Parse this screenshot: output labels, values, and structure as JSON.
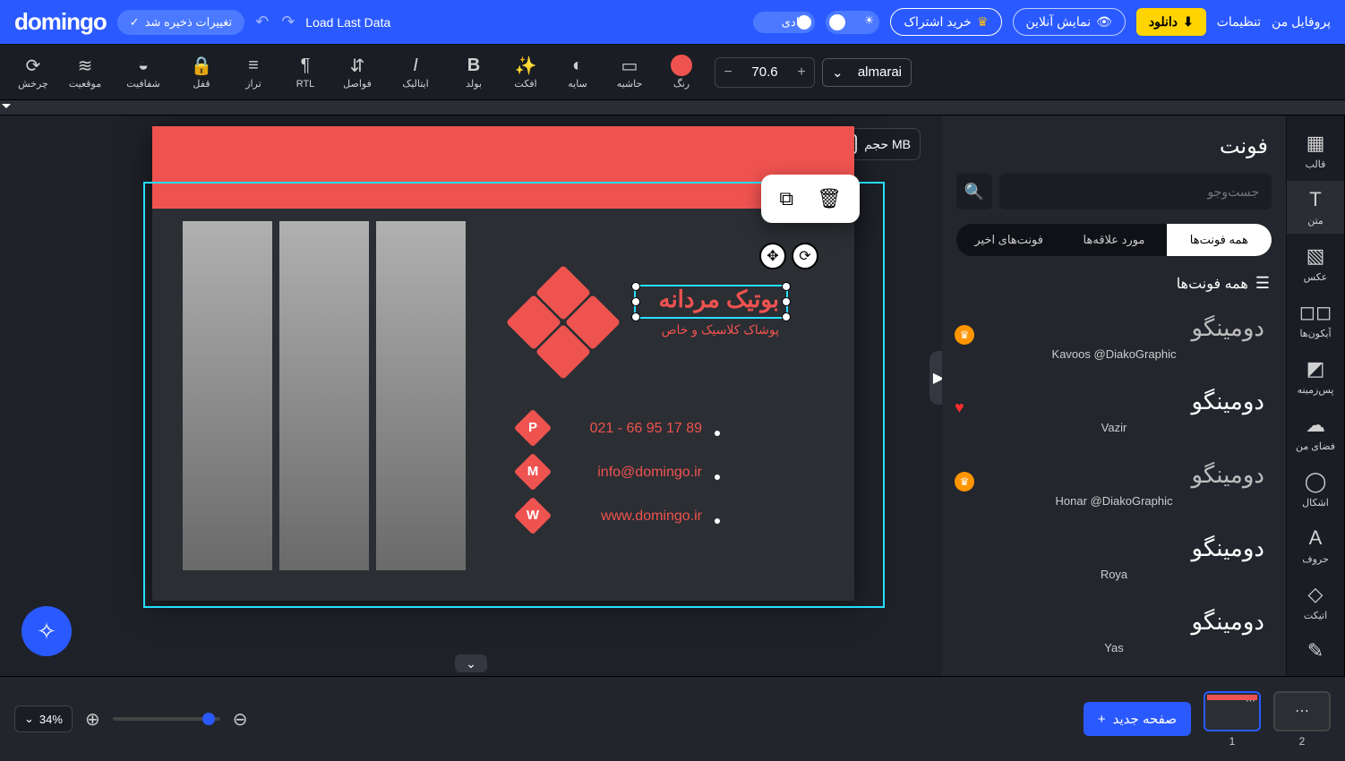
{
  "top": {
    "brand": "domingo",
    "saved": "تغییرات ذخیره شد",
    "load_last": "Load Last Data",
    "adadi": "عادی",
    "buy": "خرید اشتراک",
    "preview": "نمایش آنلاین",
    "download": "دانلود",
    "settings": "تنظیمات",
    "profile": "پروفایل من"
  },
  "toolbar": {
    "rotate": "چرخش",
    "position": "موقعیت",
    "opacity": "شفافیت",
    "lock": "قفل",
    "align": "تراز",
    "rtl": "RTL",
    "spacing": "فواصل",
    "italic": "ایتالیک",
    "bold": "بولد",
    "effect": "افکت",
    "shadow": "سایه",
    "border": "حاشیه",
    "color": "رنگ",
    "size": "70.6",
    "font": "almarai"
  },
  "canvas": {
    "size_chip": "حجم MB",
    "title": "بوتیک مردانه",
    "subtitle": "پوشاک کلاسیک و خاص",
    "phone": "021 - 66 95 17 89",
    "email": "info@domingo.ir",
    "site": "www.domingo.ir",
    "P": "P",
    "M": "M",
    "W": "W"
  },
  "panel": {
    "title": "فونت",
    "search_ph": "جست‌وجو",
    "tabs": [
      "فونت‌های اخیر",
      "مورد علاقه‌ها",
      "همه فونت‌ها"
    ],
    "section": "همه فونت‌ها",
    "fonts": [
      {
        "big": "دومینگو",
        "small": "Kavoos @DiakoGraphic",
        "badge": "crown"
      },
      {
        "big": "دومینگو",
        "small": "Vazir",
        "badge": "heart"
      },
      {
        "big": "دومینگو",
        "small": "Honar @DiakoGraphic",
        "badge": "crown"
      },
      {
        "big": "دومینگو",
        "small": "Roya",
        "badge": ""
      },
      {
        "big": "دومینگو",
        "small": "Yas",
        "badge": ""
      }
    ]
  },
  "sidebar": {
    "items": [
      {
        "label": "قالب",
        "ic": "▦"
      },
      {
        "label": "متن",
        "ic": "T"
      },
      {
        "label": "عکس",
        "ic": "▧"
      },
      {
        "label": "آیکون‌ها",
        "ic": "◻◻"
      },
      {
        "label": "پس‌زمینه",
        "ic": "◩"
      },
      {
        "label": "فضای من",
        "ic": "☁"
      },
      {
        "label": "اشکال",
        "ic": "◯"
      },
      {
        "label": "حروف",
        "ic": "A"
      },
      {
        "label": "اتیکت",
        "ic": "◇"
      },
      {
        "label": "",
        "ic": "✎"
      }
    ]
  },
  "bottom": {
    "zoom": "34%",
    "newpage": "صفحه جدید",
    "thumbs": [
      "1",
      "2"
    ]
  }
}
